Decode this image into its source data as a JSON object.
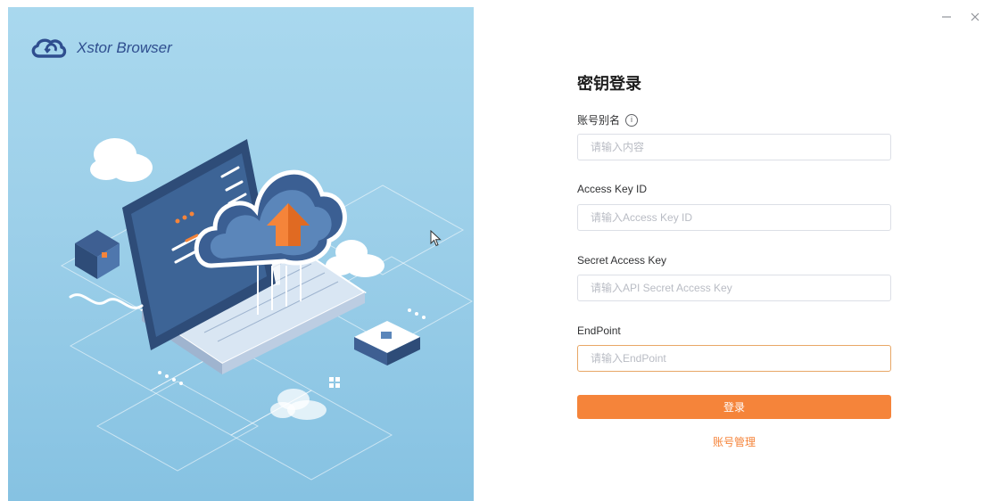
{
  "app": {
    "name": "Xstor Browser",
    "controls": {
      "minimize_icon": "minimize-icon",
      "close_icon": "close-icon"
    }
  },
  "colors": {
    "accent": "#f5843a",
    "hero_bg": "#9ccfe9",
    "brand_text": "#2f4e8f",
    "input_border": "#dcdfe6",
    "focus_border": "#e8a766"
  },
  "login": {
    "title": "密钥登录",
    "fields": [
      {
        "label": "账号别名",
        "has_info_icon": true,
        "value": "",
        "placeholder": "请输入内容"
      },
      {
        "label": "Access Key ID",
        "has_info_icon": false,
        "value": "",
        "placeholder": "请输入Access Key ID"
      },
      {
        "label": "Secret Access Key",
        "has_info_icon": false,
        "value": "",
        "placeholder": "请输入API Secret Access Key"
      },
      {
        "label": "EndPoint",
        "has_info_icon": false,
        "value": "",
        "placeholder": "请输入EndPoint",
        "focused": true
      }
    ],
    "submit_label": "登录",
    "manage_link": "账号管理"
  }
}
